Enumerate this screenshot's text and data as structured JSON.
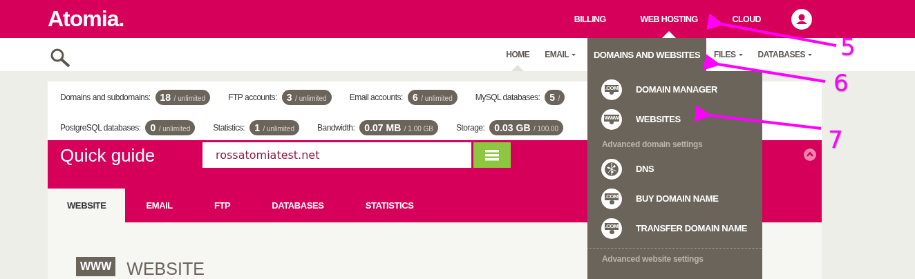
{
  "top_nav": {
    "logo": "Atomia.",
    "items": [
      {
        "label": "BILLING",
        "selected": false
      },
      {
        "label": "WEB HOSTING",
        "selected": true
      },
      {
        "label": "CLOUD",
        "selected": false
      }
    ]
  },
  "sub_nav": {
    "items": [
      {
        "label": "HOME",
        "selected": true,
        "has_menu": false
      },
      {
        "label": "EMAIL",
        "selected": false,
        "has_menu": true
      },
      {
        "label": "FILES",
        "selected": false,
        "has_menu": true
      },
      {
        "label": "DATABASES",
        "selected": false,
        "has_menu": true
      }
    ]
  },
  "stats": [
    [
      {
        "label": "Domains and subdomains:",
        "value": "18",
        "limit": "/ unlimited"
      },
      {
        "label": "FTP accounts:",
        "value": "3",
        "limit": "/ unlimited"
      },
      {
        "label": "Email accounts:",
        "value": "6",
        "limit": "/ unlimited"
      },
      {
        "label": "MySQL databases:",
        "value": "5",
        "limit": "/"
      }
    ],
    [
      {
        "label": "PostgreSQL databases:",
        "value": "0",
        "limit": "/ unlimited"
      },
      {
        "label": "Statistics:",
        "value": "1",
        "limit": "/ unlimited"
      },
      {
        "label": "Bandwidth:",
        "value": "0.07 MB",
        "limit": "/ 1.00 GB"
      },
      {
        "label": "Storage:",
        "value": "0.03 GB",
        "limit": "/ 100.00"
      }
    ]
  ],
  "quick_guide": {
    "title": "Quick guide",
    "domain": "rossatomiatest.net",
    "tabs": [
      {
        "label": "WEBSITE",
        "selected": true
      },
      {
        "label": "EMAIL",
        "selected": false
      },
      {
        "label": "FTP",
        "selected": false
      },
      {
        "label": "DATABASES",
        "selected": false
      },
      {
        "label": "STATISTICS",
        "selected": false
      }
    ],
    "section_badge": "WWW",
    "section_title": "WEBSITE"
  },
  "dropdown": {
    "header": "DOMAINS AND WEBSITES",
    "entries": [
      {
        "kind": "domain",
        "icon_text": ".COM",
        "label": "DOMAIN MANAGER"
      },
      {
        "kind": "website",
        "icon_text": "WWW",
        "label": "WEBSITES"
      },
      {
        "kind": "heading",
        "label": "Advanced domain settings"
      },
      {
        "kind": "dns",
        "label": "DNS"
      },
      {
        "kind": "buy",
        "icon_text": ".COM",
        "label": "BUY DOMAIN NAME"
      },
      {
        "kind": "transfer",
        "icon_text": ".COM",
        "label": "TRANSFER DOMAIN NAME"
      },
      {
        "kind": "divider"
      },
      {
        "kind": "heading",
        "label": "Advanced website settings"
      }
    ]
  },
  "annotations": [
    {
      "number": "5"
    },
    {
      "number": "6"
    },
    {
      "number": "7"
    }
  ]
}
